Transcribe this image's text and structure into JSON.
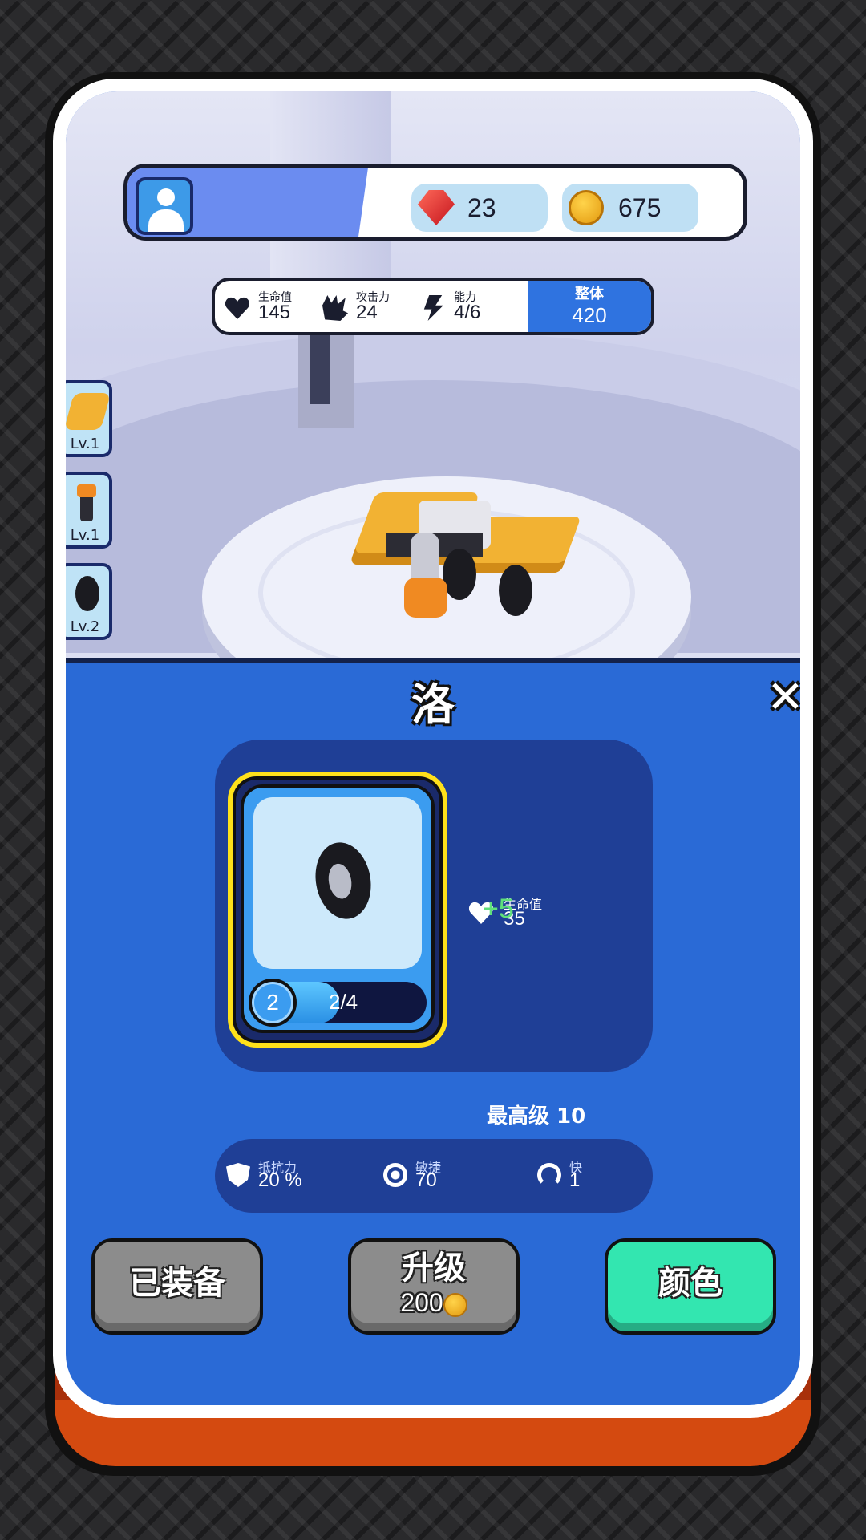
{
  "header": {
    "gems": "23",
    "coins": "675"
  },
  "stats": {
    "hp_label": "生命值",
    "hp_value": "145",
    "attack_label": "攻击力",
    "attack_value": "24",
    "ability_label": "能力",
    "ability_value": "4/6",
    "overall_label": "整体",
    "overall_value": "420"
  },
  "slots": [
    {
      "level": "Lv.1",
      "icon": "car-body-icon"
    },
    {
      "level": "Lv.1",
      "icon": "hammer-icon"
    },
    {
      "level": "Lv.2",
      "icon": "wheel-icon"
    }
  ],
  "panel": {
    "title": "洛",
    "close_icon": "✕",
    "item": {
      "level": "2",
      "progress_text": "2/4",
      "progress": 0.5,
      "icon": "wheel-icon"
    },
    "hp_label": "生命值",
    "hp_value": "35",
    "hp_bonus": "+5",
    "max_level": "最高级 10",
    "attributes": [
      {
        "label": "抵抗力",
        "value": "20 %",
        "icon": "shield-icon"
      },
      {
        "label": "敏捷",
        "value": "70",
        "icon": "steering-wheel-icon"
      },
      {
        "label": "快",
        "value": "1",
        "icon": "speedometer-icon"
      }
    ]
  },
  "buttons": {
    "equipped": "已装备",
    "upgrade": "升级",
    "upgrade_cost": "200",
    "color": "颜色"
  },
  "colors": {
    "panel_blue": "#2a6ad6",
    "upgrade_bonus": "#5fe07a",
    "color_button": "#33e6b0",
    "card_border": "#ffe11a"
  }
}
